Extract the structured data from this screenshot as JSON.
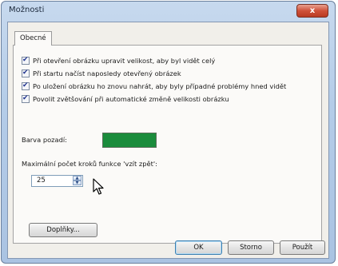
{
  "window": {
    "title": "Možnosti",
    "close_label": "x"
  },
  "tabs": [
    {
      "label": "Obecné"
    }
  ],
  "options": [
    {
      "label": "Při otevření obrázku upravit velikost, aby byl vidět celý",
      "checked": true
    },
    {
      "label": "Při startu načíst naposledy otevřený obrázek",
      "checked": true
    },
    {
      "label": "Po uložení obrázku ho znovu nahrát, aby byly případné problémy hned vidět",
      "checked": true
    },
    {
      "label": "Povolit zvětšování při automatické změně velikosti obrázku",
      "checked": true
    }
  ],
  "background": {
    "label": "Barva pozadí:",
    "color": "#1a8c3c"
  },
  "undo": {
    "label": "Maximální počet kroků funkce 'vzít zpět':",
    "value": "25"
  },
  "buttons": {
    "addons": "Doplňky...",
    "ok": "OK",
    "cancel": "Storno",
    "apply": "Použít"
  },
  "check_glyph": "✔",
  "icons": {
    "spin_up": "triangle-up",
    "spin_down": "triangle-down",
    "cursor": "arrow-pointer"
  }
}
